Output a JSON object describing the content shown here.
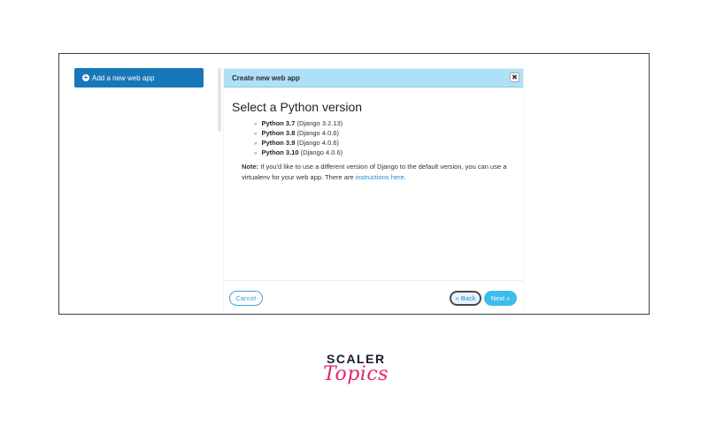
{
  "sidebar": {
    "add_app_label": "Add a new web app"
  },
  "dialog": {
    "title": "Create new web app",
    "close_symbol": "✖",
    "heading": "Select a Python version",
    "versions": [
      {
        "name": "Python 3.7",
        "django": "(Django 3.2.13)"
      },
      {
        "name": "Python 3.8",
        "django": "(Django 4.0.6)"
      },
      {
        "name": "Python 3.9",
        "django": "(Django 4.0.6)"
      },
      {
        "name": "Python 3.10",
        "django": "(Django 4.0.6)"
      }
    ],
    "note": {
      "label": "Note:",
      "text": " If you'd like to use a different version of Django to the default version, you can use a virtualenv for your web app. There are ",
      "link": "instructions here",
      "end": "."
    },
    "buttons": {
      "cancel": "Cancel",
      "back": "« Back",
      "next": "Next »"
    }
  },
  "brand": {
    "line1": "SCALER",
    "line2": "Topics"
  },
  "colors": {
    "primary_button": "#1877b8",
    "dialog_header": "#aee1f7",
    "link": "#1f8dd6",
    "next_button": "#3cbdea",
    "brand_pink": "#e0266f"
  }
}
